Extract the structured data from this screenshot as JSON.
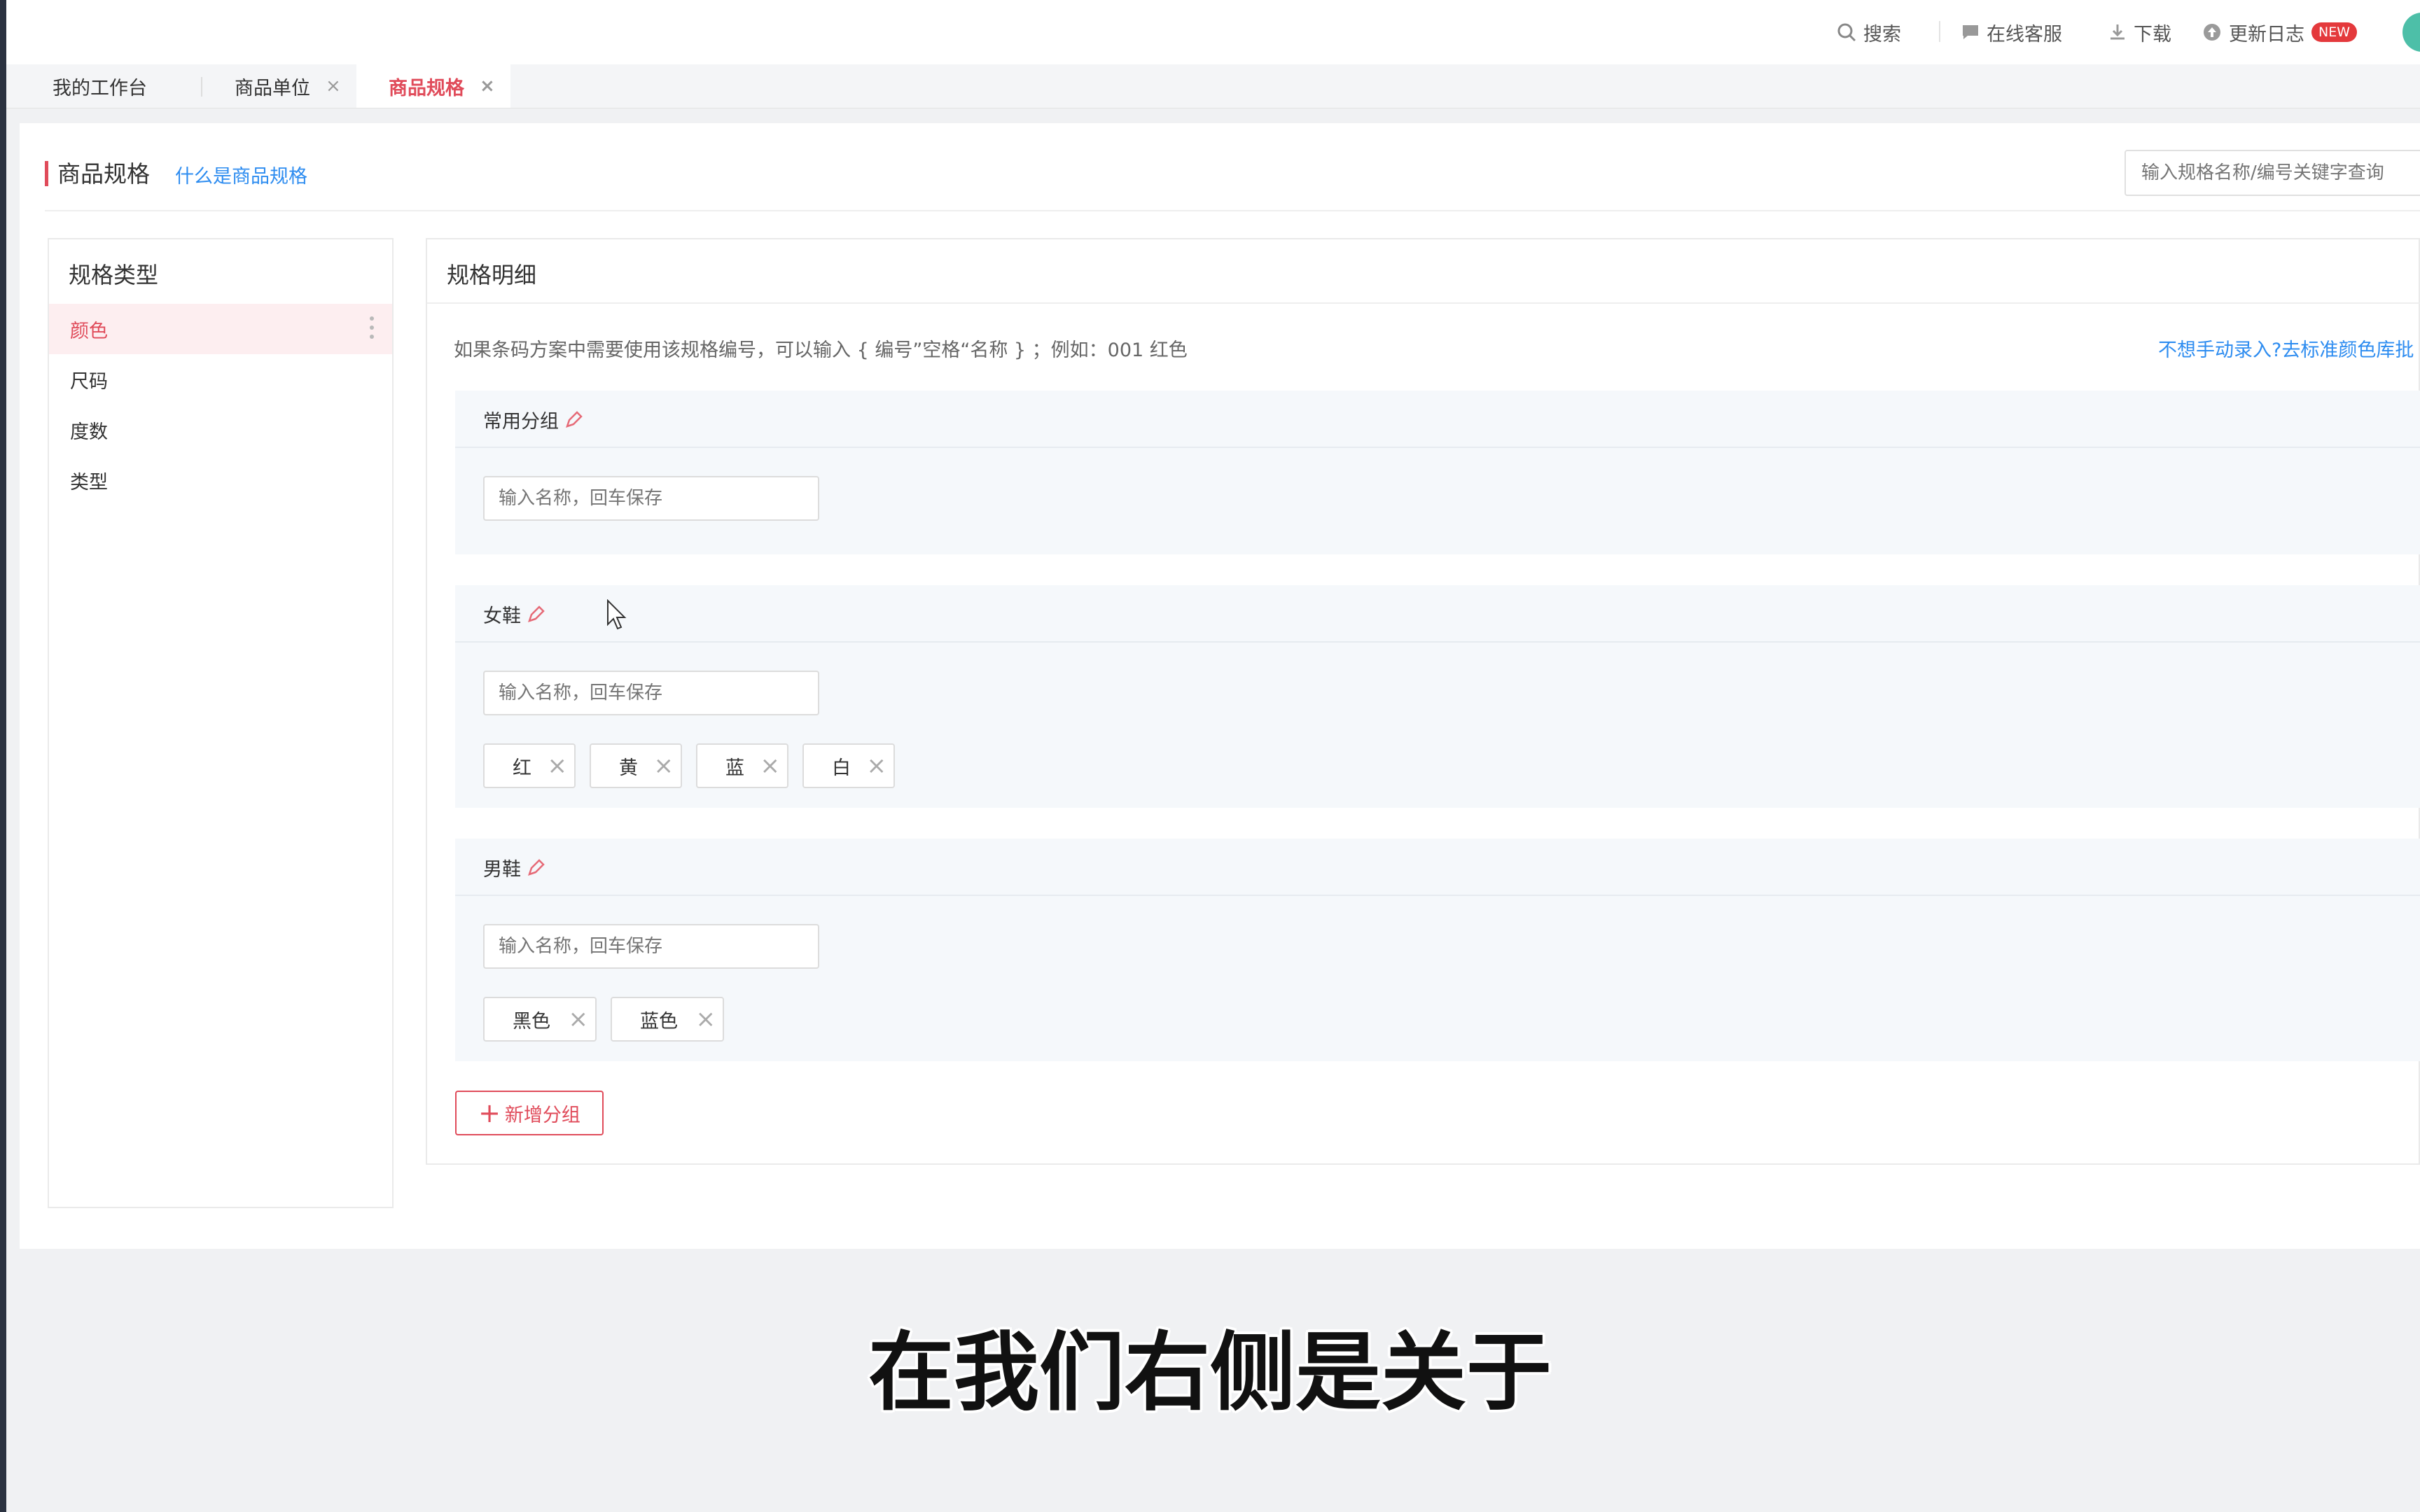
{
  "topbar": {
    "search_label": "搜索",
    "service_label": "在线客服",
    "download_label": "下载",
    "changelog_label": "更新日志",
    "new_badge": "NEW"
  },
  "tabs": [
    {
      "label": "我的工作台",
      "closable": false,
      "active": false
    },
    {
      "label": "商品单位",
      "closable": true,
      "active": false
    },
    {
      "label": "商品规格",
      "closable": true,
      "active": true
    }
  ],
  "tab_close_glyph": "×",
  "page": {
    "title": "商品规格",
    "help_link": "什么是商品规格",
    "search_placeholder": "输入规格名称/编号关键字查询"
  },
  "spec_types": {
    "title": "规格类型",
    "items": [
      "颜色",
      "尺码",
      "度数",
      "类型"
    ],
    "active_index": 0
  },
  "spec_detail": {
    "title": "规格明细",
    "hint": "如果条码方案中需要使用该规格编号，可以输入 { 编号”空格“名称 } ；例如：001 红色",
    "standard_link": "不想手动录入?去标准颜色库批",
    "input_placeholder": "输入名称，回车保存",
    "groups": [
      {
        "name": "常用分组",
        "values": []
      },
      {
        "name": "女鞋",
        "values": [
          "红",
          "黄",
          "蓝",
          "白"
        ]
      },
      {
        "name": "男鞋",
        "values": [
          "黑色",
          "蓝色"
        ]
      }
    ],
    "add_group_label": "新增分组"
  },
  "subtitle": "在我们右侧是关于",
  "colors": {
    "accent": "#e04b5a",
    "link": "#2d8cf0",
    "group_bg": "#f5f8fb"
  }
}
